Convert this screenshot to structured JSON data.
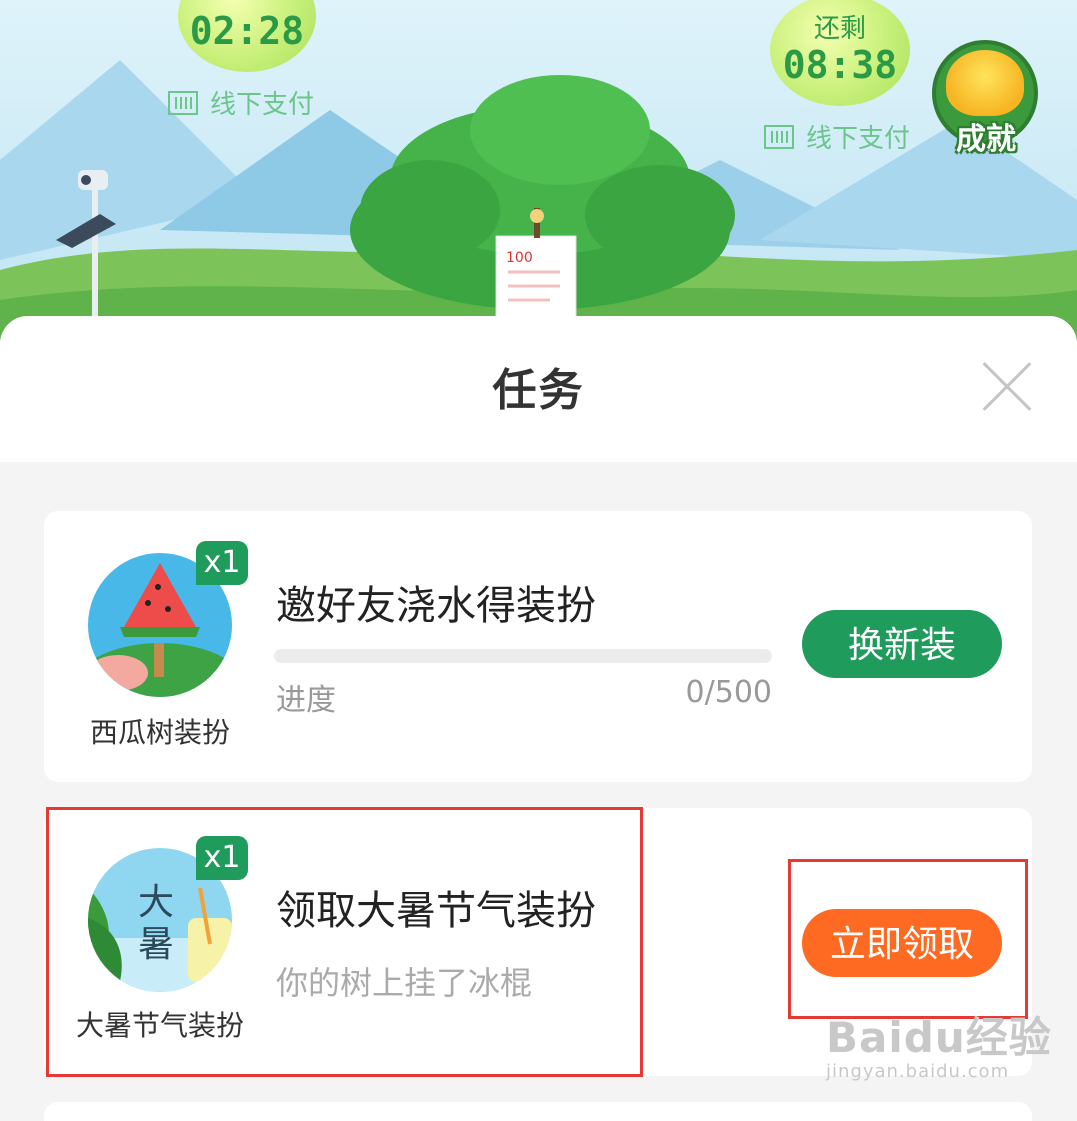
{
  "scene": {
    "timer1": {
      "time": "02:28"
    },
    "timer2": {
      "label": "还剩",
      "time": "08:38"
    },
    "offline_pay_1": "线下支付",
    "offline_pay_2": "线下支付",
    "achievement_label": "成就",
    "notice_text": "100"
  },
  "sheet": {
    "title": "任务"
  },
  "tasks": [
    {
      "title": "邀好友浇水得装扮",
      "prize_name": "西瓜树装扮",
      "badge": "x1",
      "progress_label": "进度",
      "progress_text": "0/500",
      "progress_fraction": 0,
      "button_label": "换新装",
      "button_color": "#1f9b5b"
    },
    {
      "title": "领取大暑节气装扮",
      "prize_name": "大暑节气装扮",
      "prize_image_text_1": "大",
      "prize_image_text_2": "暑",
      "badge": "x1",
      "description": "你的树上挂了冰棍",
      "button_label": "立即领取",
      "button_color": "#ff6a23"
    }
  ],
  "highlight_color": "#e53935",
  "watermark": {
    "logo": "Baidu经验",
    "url": "jingyan.baidu.com"
  }
}
